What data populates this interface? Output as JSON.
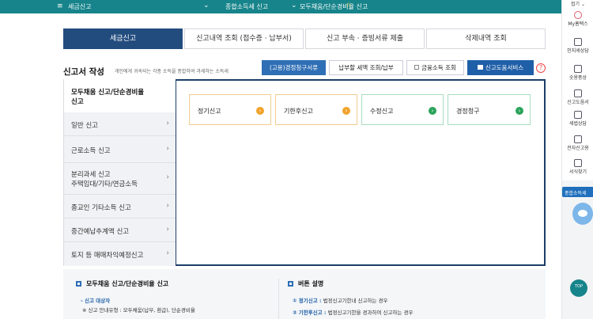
{
  "topbar": {
    "menu_icon": "≡",
    "crumb1": "세금신고",
    "crumb2": "종합소득세 신고",
    "crumb3": "모두채움/단순경비율 신고",
    "star": "☆",
    "chevron": "⌄"
  },
  "page_title": "종합소득세 신고",
  "right_sidebar": {
    "fold_label": "접기 ⌄",
    "items": [
      "My홈택스",
      "인지세상담",
      "숫용풍상",
      "신고도움서",
      "세법상담",
      "전자신고용",
      "서식찾기"
    ],
    "gov_button": "종합소득세",
    "top_button": "TOP"
  },
  "tabs": [
    "세금신고",
    "신고내역 조회 (접수증 · 납부서)",
    "신고 부속 · 증빙서류 제출",
    "삭제내역 조회"
  ],
  "section": {
    "title": "신고서 작성",
    "desc": "개인에게 귀속되는 각종 소득을 종합하여 과세하는 소득세"
  },
  "action_buttons": {
    "b1": "(고용)경정청구서류",
    "b2": "납부할 세액 조회/납부",
    "b3": "금융소득 조회",
    "b4": "신고도움서비스",
    "help": "?"
  },
  "left_menu": [
    {
      "label": "모두채움 신고/단순경비율 신고",
      "line2": "신고",
      "line1": "모두채움 신고/단순경비율"
    },
    {
      "label": "일반 신고"
    },
    {
      "label": "근로소득 신고"
    },
    {
      "label": "분리과세 신고",
      "line2": "주택임대/기타/연금소득"
    },
    {
      "label": "종교인 기타소득 신고"
    },
    {
      "label": "중간예납추계액 신고"
    },
    {
      "label": "토지 등 매매차익예정신고"
    }
  ],
  "cards": [
    {
      "label": "정기신고",
      "icon": "›"
    },
    {
      "label": "기한후신고",
      "icon": "›"
    },
    {
      "label": "수정신고",
      "icon": "›"
    },
    {
      "label": "경정청구",
      "icon": "›"
    }
  ],
  "bottom": {
    "left_title": "모두채움 신고/단순경비율 신고",
    "left_sub": "- 신고 대상자",
    "left_item": "※ 신고 안내유형 : 모두채움(납부, 환급), 단순경비율",
    "right_title": "버튼 설명",
    "right_1_key": "① 정기신고 :",
    "right_1_val": " 법정신고기한내 신고하는 경우",
    "right_2_key": "② 기한후신고 :",
    "right_2_val": " 법정신고기한을 경과하여 신고하는 경우"
  }
}
